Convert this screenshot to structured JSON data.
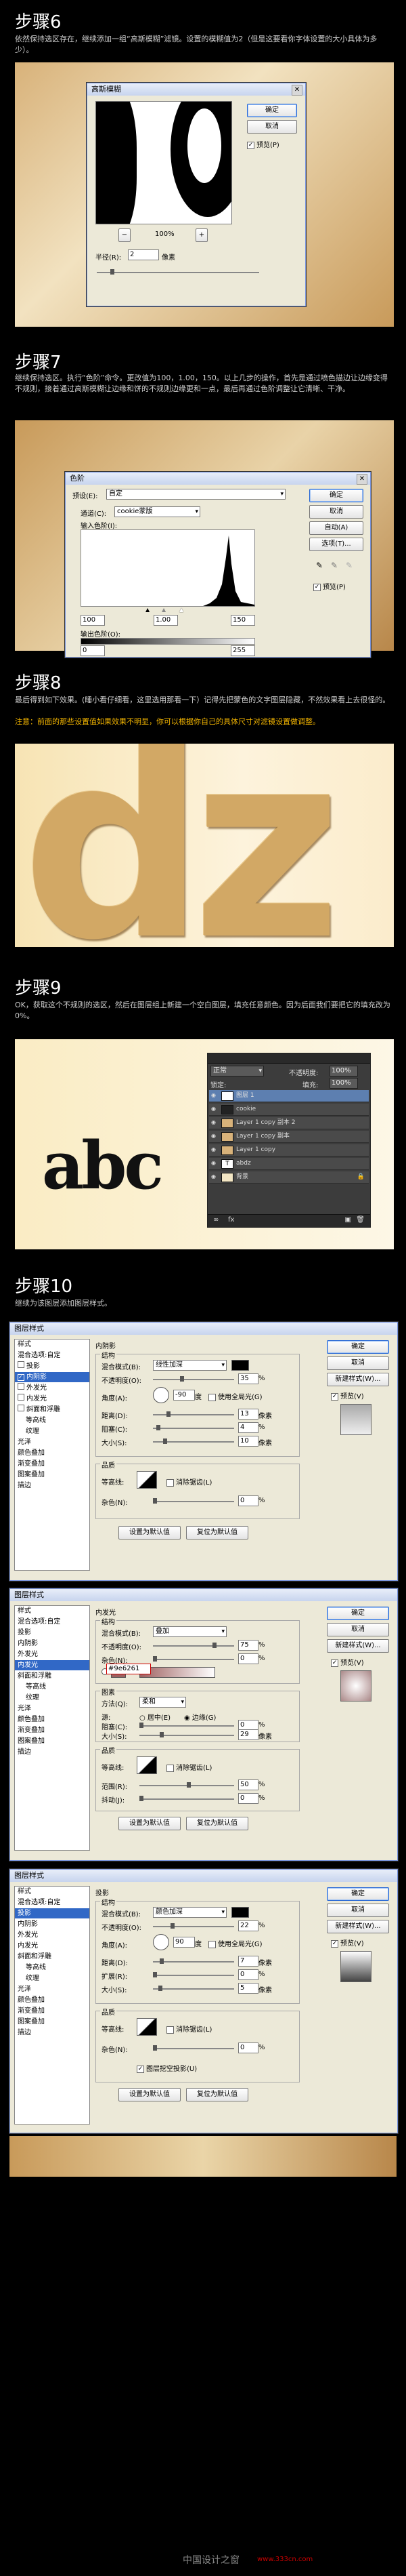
{
  "step6": {
    "title": "步骤6",
    "text": "依然保持选区存在，继续添加一组“高斯模糊”滤镜。设置的模糊值为2（但是这要看你字体设置的大小具体为多少）。",
    "dialog": {
      "title": "高斯模糊",
      "ok": "确定",
      "cancel": "取消",
      "preview": "预览(P)",
      "zoom": "100%",
      "radius_label": "半径(R):",
      "radius_value": "2",
      "radius_unit": "像素"
    }
  },
  "step7": {
    "title": "步骤7",
    "text": "继续保持选区。执行“色阶”命令。更改值为100，1.00，150。以上几步的操作，首先是通过喷色描边让边缘变得不规则，接着通过高斯模糊让边缘和饼的不规则边缘更和一点，最后再通过色阶调整让它清晰、干净。",
    "dialog": {
      "title": "色阶",
      "preset_label": "预设(E):",
      "preset_value": "自定",
      "channel_label": "通道(C):",
      "channel_value": "cookie蒙版",
      "input_label": "输入色阶(I):",
      "input_values": [
        "100",
        "1.00",
        "150"
      ],
      "output_label": "输出色阶(O):",
      "output_values": [
        "0",
        "255"
      ],
      "ok": "确定",
      "cancel": "取消",
      "auto": "自动(A)",
      "options": "选项(T)...",
      "preview": "预览(P)"
    }
  },
  "step8": {
    "title": "步骤8",
    "text": "最后得到如下效果。(睡小看仔细看，这里选用那看一下）记得先把蒙色的文字图层隐藏，不然效果看上去很怪的。",
    "note": "注意：前面的那些设置值如果效果不明显，你可以根据你自己的具体尺寸对滤镜设置做调整。",
    "image_text": "dz"
  },
  "step9": {
    "title": "步骤9",
    "text": "OK，获取这个不规则的选区，然后在图层组上新建一个空白图层，填充任意颜色。因为后面我们要把它的填充改为0%。",
    "image_text": "abc",
    "layers": {
      "blend_mode": "正常",
      "opacity_label": "不透明度:",
      "opacity": "100%",
      "lock_label": "锁定:",
      "fill_label": "填充:",
      "fill": "100%",
      "items": [
        "图层 1",
        "cookie",
        "Layer 1 copy 副本 2",
        "Layer 1 copy 副本",
        "Layer 1 copy",
        "abdz",
        "背景"
      ]
    }
  },
  "step10": {
    "title": "步骤10",
    "text": "继续为该图层添加图层样式。",
    "dialog_title": "图层样式",
    "styles_header": "样式",
    "blend_options": "混合选项:自定",
    "style_list": [
      "投影",
      "内阴影",
      "外发光",
      "内发光",
      "斜面和浮雕",
      "等高线",
      "纹理",
      "光泽",
      "颜色叠加",
      "渐变叠加",
      "图案叠加",
      "描边"
    ],
    "ok": "确定",
    "cancel": "取消",
    "new_style": "新建样式(W)...",
    "preview": "预览(V)",
    "inner_shadow": {
      "section": "内阴影",
      "structure": "结构",
      "blend_label": "混合模式(B):",
      "blend_value": "线性加深",
      "opacity_label": "不透明度(O):",
      "opacity": "35",
      "angle_label": "角度(A):",
      "angle": "-90",
      "global_light": "使用全局光(G)",
      "distance_label": "距离(D):",
      "distance": "13",
      "choke_label": "阻塞(C):",
      "choke": "4",
      "size_label": "大小(S):",
      "size": "10",
      "quality": "品质",
      "contour_label": "等高线:",
      "anti_alias": "消除锯齿(L)",
      "noise_label": "杂色(N):",
      "noise": "0",
      "make_default": "设置为默认值",
      "reset_default": "复位为默认值"
    },
    "inner_glow": {
      "section": "内发光",
      "structure": "结构",
      "blend_label": "混合模式(B):",
      "blend_value": "叠加",
      "opacity_label": "不透明度(O):",
      "opacity": "75",
      "noise_label": "杂色(N):",
      "noise": "0",
      "color_hex": "#9e6261",
      "elements": "图素",
      "method_label": "方法(Q):",
      "method_value": "柔和",
      "source_label": "源:",
      "center": "居中(E)",
      "edge": "边缘(G)",
      "choke_label": "阻塞(C):",
      "choke": "0",
      "size_label": "大小(S):",
      "size": "29",
      "quality": "品质",
      "contour_label": "等高线:",
      "anti_alias": "消除锯齿(L)",
      "range_label": "范围(R):",
      "range": "50",
      "jitter_label": "抖动(J):",
      "jitter": "0",
      "make_default": "设置为默认值",
      "reset_default": "复位为默认值"
    },
    "drop_shadow": {
      "section": "投影",
      "structure": "结构",
      "blend_label": "混合模式(B):",
      "blend_value": "颜色加深",
      "opacity_label": "不透明度(O):",
      "opacity": "22",
      "angle_label": "角度(A):",
      "angle": "90",
      "global_light": "使用全局光(G)",
      "distance_label": "距离(D):",
      "distance": "7",
      "spread_label": "扩展(R):",
      "spread": "0",
      "size_label": "大小(S):",
      "size": "5",
      "quality": "品质",
      "contour_label": "等高线:",
      "anti_alias": "消除锯齿(L)",
      "noise_label": "杂色(N):",
      "noise": "0",
      "knockout": "图层挖空投影(U)",
      "make_default": "设置为默认值",
      "reset_default": "复位为默认值"
    }
  },
  "footer": {
    "site": "中国设计之窗",
    "url": "www.333cn.com"
  }
}
